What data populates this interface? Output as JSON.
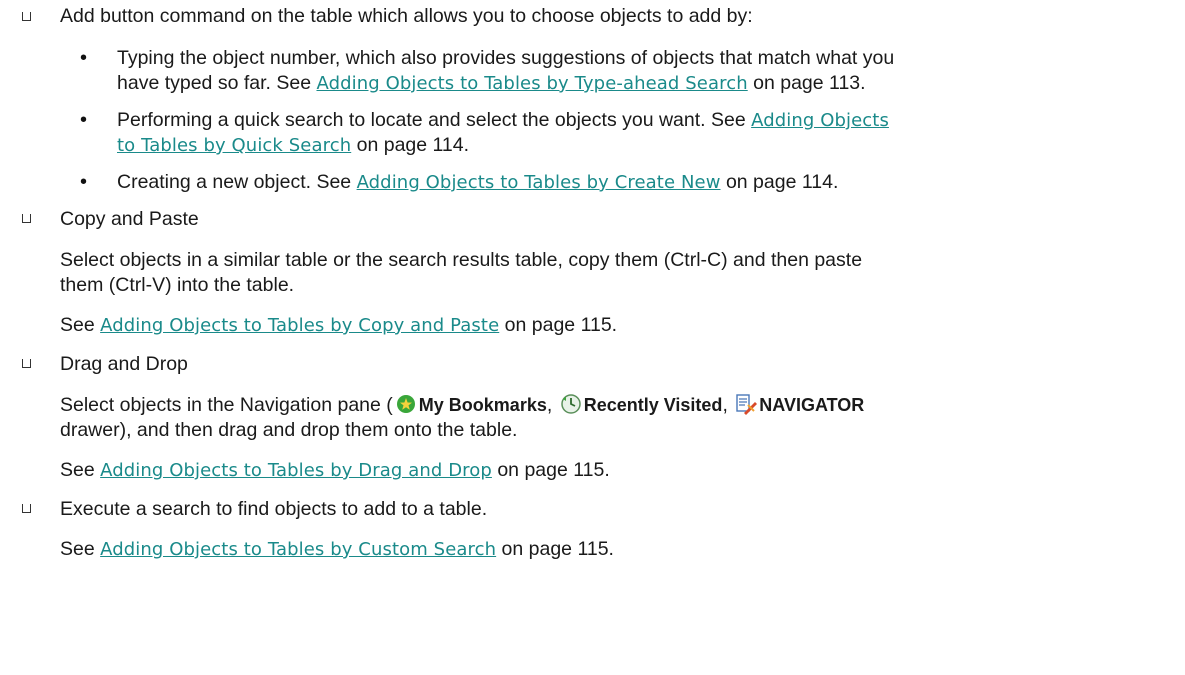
{
  "items": {
    "add_button": {
      "text": "Add button command on the table which allows you to choose objects to add by:",
      "subitems": [
        {
          "line1_pre": "Typing the object number, which also provides suggestions of objects that match what you",
          "line2_pre": "have typed so far. See ",
          "link": "Adding Objects to Tables by Type-ahead Search",
          "post": " on page 113."
        },
        {
          "line1_pre": "Performing a quick search to locate and select the objects you want. See ",
          "link_part1": "Adding Objects",
          "link_part2": "to Tables by Quick Search",
          "post": " on page 114."
        },
        {
          "pre": "Creating a new object. See ",
          "link": "Adding Objects to Tables by Create New",
          "post": " on page 114."
        }
      ]
    },
    "copy_paste": {
      "title": "Copy and Paste",
      "desc_line1": "Select objects in a similar table or the search results table, copy them (Ctrl-C) and then paste",
      "desc_line2": "them (Ctrl-V) into the table.",
      "see": "See ",
      "link": "Adding Objects to Tables by Copy and Paste",
      "post": " on page 115."
    },
    "drag_drop": {
      "title": "Drag and Drop",
      "desc_pre": "Select objects in the Navigation pane (",
      "bookmarks": "My Bookmarks",
      "comma1": ", ",
      "recent": "Recently Visited",
      "comma2": ", ",
      "navigator": "NAVIGATOR",
      "desc_line2": "drawer), and then drag and drop them onto the table.",
      "see": "See ",
      "link": "Adding Objects to Tables by Drag and Drop",
      "post": " on page 115."
    },
    "custom_search": {
      "title": "Execute a search to find objects to add to a table.",
      "see": "See ",
      "link": "Adding Objects to Tables by Custom Search",
      "post": " on page 115."
    }
  },
  "icons": {
    "bookmarks": "bookmark-star-icon",
    "recent": "recently-visited-clock-icon",
    "navigator": "navigator-icon"
  },
  "colors": {
    "link": "#1a8a8a",
    "text": "#1a1a1a",
    "bookmark_green": "#3aa63a"
  }
}
